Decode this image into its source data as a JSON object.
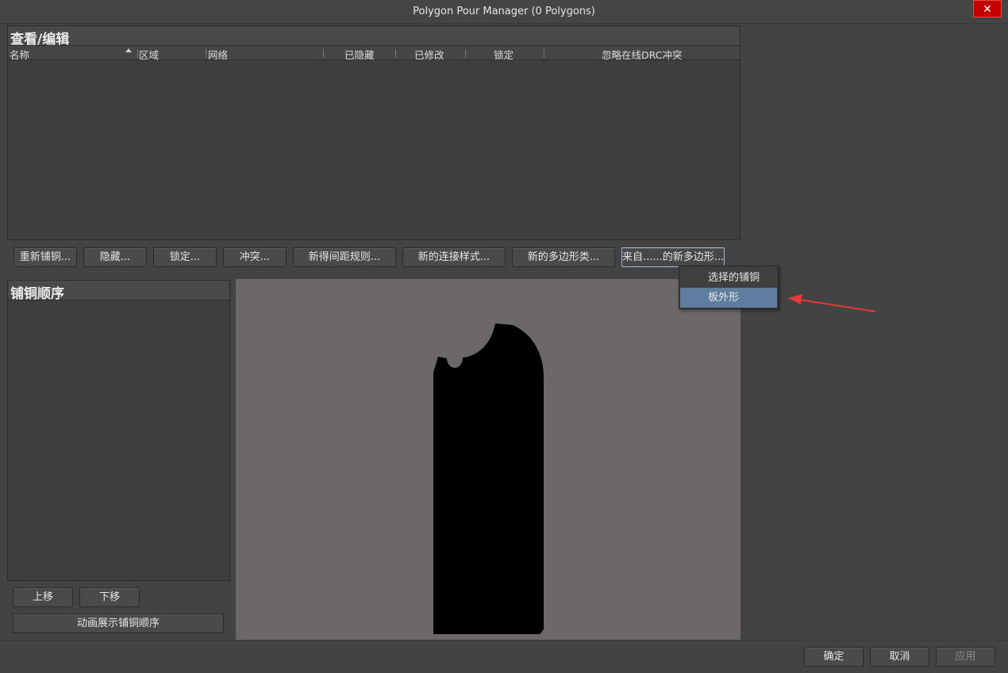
{
  "window": {
    "title": "Polygon Pour Manager (0 Polygons)",
    "close_label": "✕"
  },
  "view_panel": {
    "header": "查看/编辑",
    "columns": [
      "名称",
      "区域",
      "网络",
      "已隐藏",
      "已修改",
      "锁定",
      "忽略在线DRC冲突"
    ]
  },
  "toolbar": {
    "buttons": [
      "重新铺铜...",
      "隐藏...",
      "锁定...",
      "冲突...",
      "新得间距规则...",
      "新的连接样式...",
      "新的多边形类...",
      "来自......的新多边形..."
    ]
  },
  "dropdown": {
    "items": [
      "选择的铺铜",
      "板外形"
    ],
    "highlighted": "板外形"
  },
  "order_panel": {
    "header": "铺铜顺序",
    "move_up": "上移",
    "move_down": "下移",
    "animate": "动画展示铺铜顺序"
  },
  "footer": {
    "ok": "确定",
    "cancel": "取消",
    "apply": "应用"
  },
  "colors": {
    "accent_highlight": "#5f7d9e",
    "arrow": "#e53935",
    "shape_fill": "#000000",
    "preview_bg": "#6b6867",
    "close_red": "#c50000"
  }
}
